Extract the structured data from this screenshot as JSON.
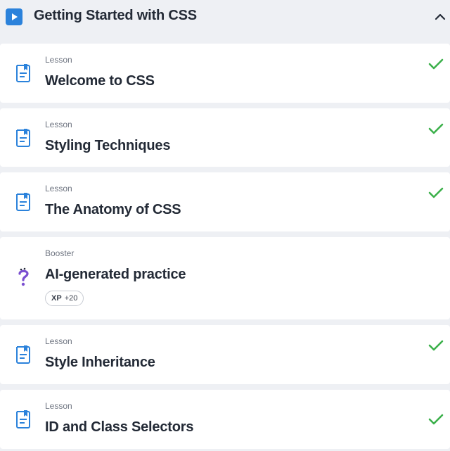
{
  "header": {
    "title": "Getting Started with CSS",
    "icon": "play-icon",
    "toggle_icon": "chevron-up-icon",
    "accent": "#2b82db"
  },
  "items": [
    {
      "type": "Lesson",
      "title": "Welcome to CSS",
      "completed": true
    },
    {
      "type": "Lesson",
      "title": "Styling Techniques",
      "completed": true
    },
    {
      "type": "Lesson",
      "title": "The Anatomy of CSS",
      "completed": true
    },
    {
      "type": "Booster",
      "title": "AI-generated practice",
      "completed": false,
      "xp_label": "XP",
      "xp_value": "+20"
    },
    {
      "type": "Lesson",
      "title": "Style Inheritance",
      "completed": true
    },
    {
      "type": "Lesson",
      "title": "ID and Class Selectors",
      "completed": true
    }
  ],
  "colors": {
    "check": "#3bb04a",
    "lesson_icon": "#2b82db",
    "booster_icon": "#7a4fd0"
  }
}
